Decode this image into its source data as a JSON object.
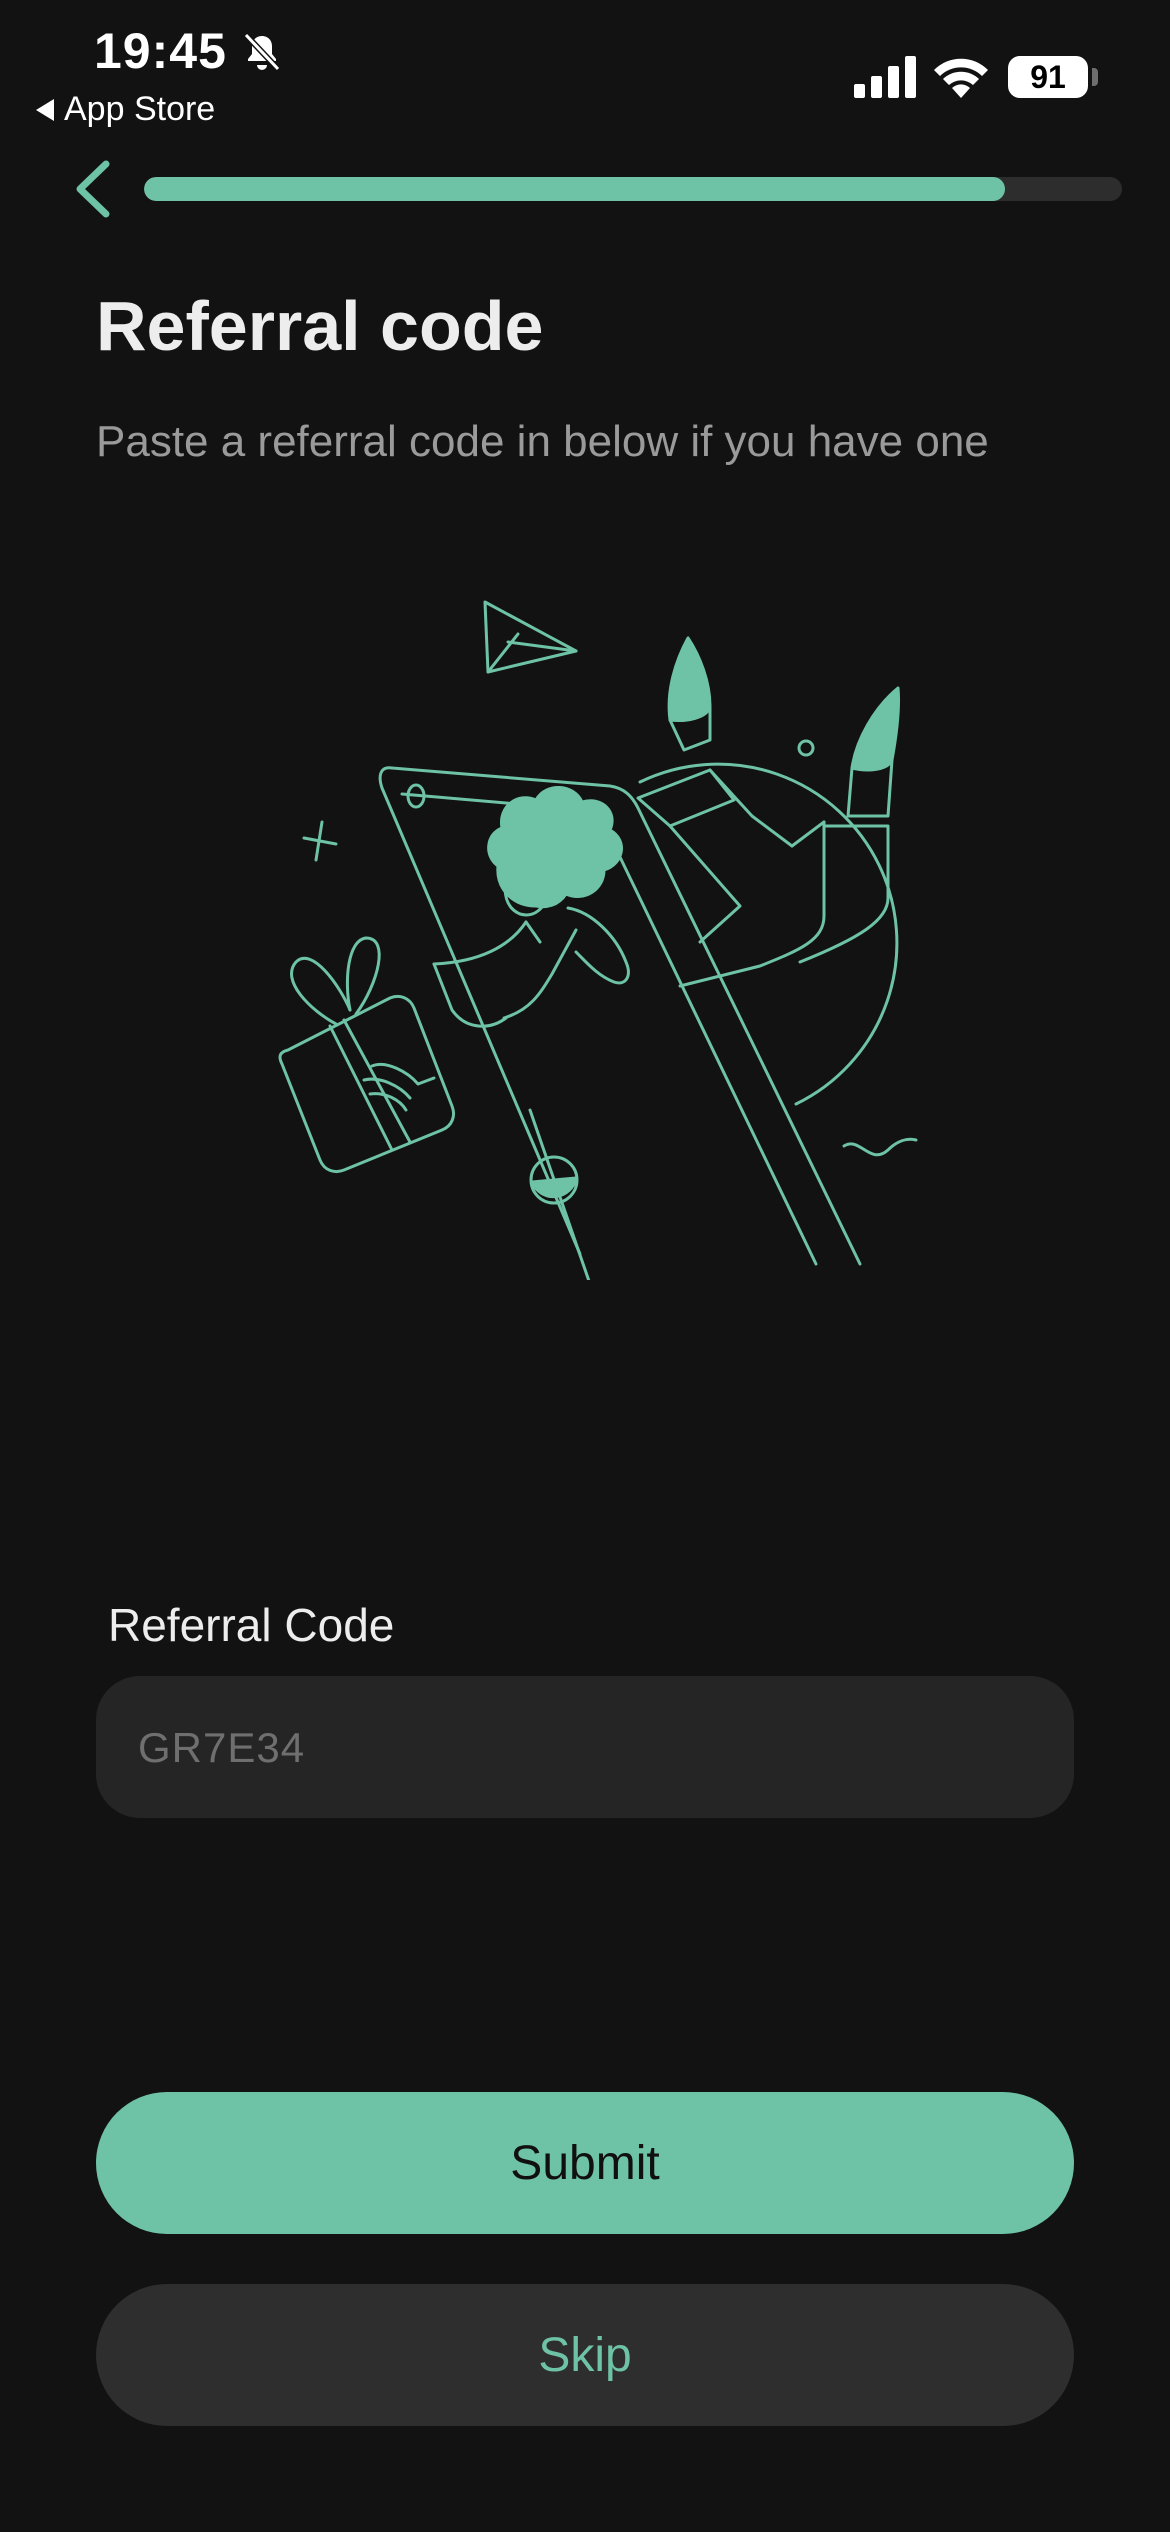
{
  "status_bar": {
    "time": "19:45",
    "back_app": "App Store",
    "battery": "91",
    "icons": [
      "bell-slash-icon",
      "cellular-signal-icon",
      "wifi-icon",
      "battery-icon"
    ]
  },
  "nav": {
    "back_icon": "chevron-left-icon",
    "progress": 0.88
  },
  "header": {
    "title": "Referral code",
    "subtitle": "Paste a referral code in below if you have one"
  },
  "illustration": {
    "name": "gift-delivery-through-phone-illustration"
  },
  "form": {
    "label": "Referral Code",
    "placeholder": "GR7E34",
    "value": ""
  },
  "actions": {
    "submit_label": "Submit",
    "skip_label": "Skip"
  },
  "colors": {
    "accent": "#6ec3a6",
    "background": "#121212",
    "field_bg": "#252525",
    "secondary_button_bg": "#2e2e2e",
    "progress_track": "#2d2d2d"
  }
}
